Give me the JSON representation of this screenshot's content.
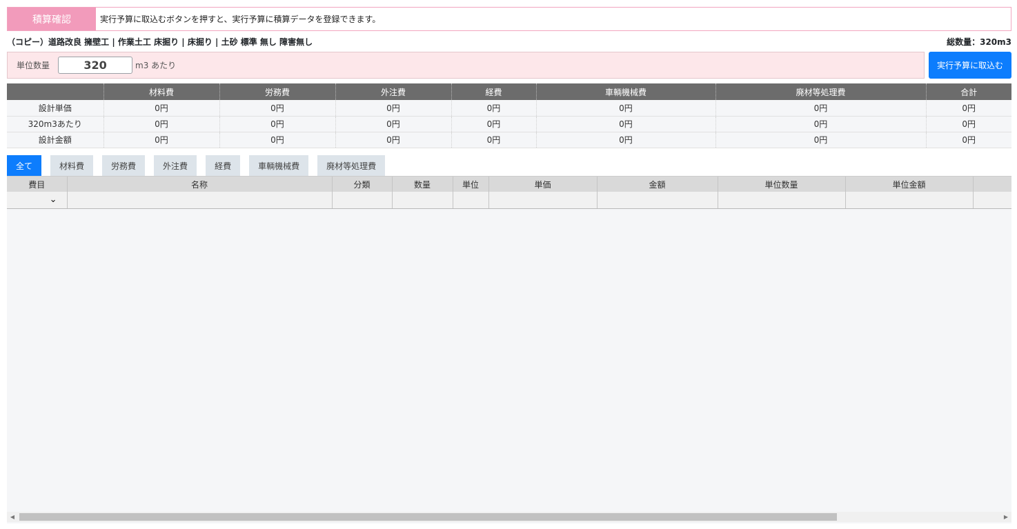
{
  "banner": {
    "title": "積算確認",
    "message": "実行予算に取込むボタンを押すと、実行予算に積算データを登録できます。"
  },
  "info": {
    "path": "（コピー）道路改良 擁壁工 | 作業土工 床掘り | 床掘り | 土砂 標準 無し 障害無し",
    "total": "総数量：320m3"
  },
  "unit": {
    "label": "単位数量",
    "value": "320",
    "suffix": "m3 あたり"
  },
  "import_button": "実行予算に取込む",
  "summary": {
    "headers": [
      "",
      "材料費",
      "労務費",
      "外注費",
      "経費",
      "車輌機械費",
      "廃材等処理費",
      "合計"
    ],
    "rows": [
      [
        "設計単価",
        "0円",
        "0円",
        "0円",
        "0円",
        "0円",
        "0円",
        "0円"
      ],
      [
        "320m3あたり",
        "0円",
        "0円",
        "0円",
        "0円",
        "0円",
        "0円",
        "0円"
      ],
      [
        "設計金額",
        "0円",
        "0円",
        "0円",
        "0円",
        "0円",
        "0円",
        "0円"
      ]
    ]
  },
  "tabs": [
    "全て",
    "材料費",
    "労務費",
    "外注費",
    "経費",
    "車輌機械費",
    "廃材等処理費"
  ],
  "active_tab": 0,
  "grid": {
    "headers": [
      "費目",
      "名称",
      "分類",
      "数量",
      "単位",
      "単価",
      "金額",
      "単位数量",
      "単位金額",
      ""
    ]
  },
  "colors": {
    "accent": "#0d7dfd",
    "banner": "#f29bbb",
    "unit_bg": "#fde7ea",
    "header_dark": "#6c6c6c"
  }
}
